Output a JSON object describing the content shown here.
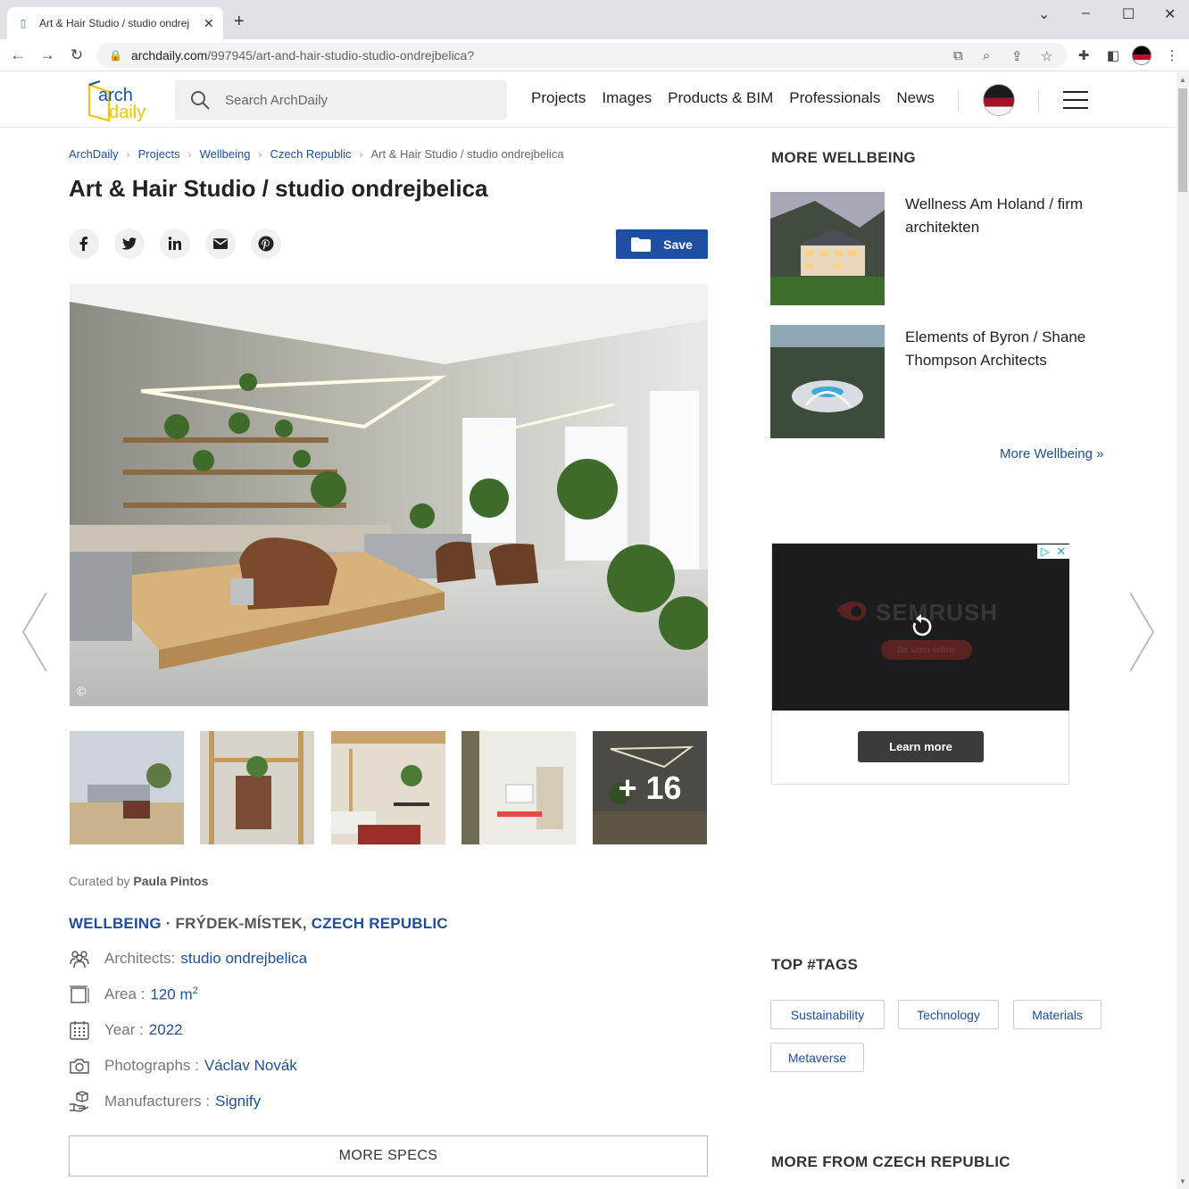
{
  "browser": {
    "tab_title": "Art & Hair Studio / studio ondrej",
    "tab_close": "✕",
    "new_tab": "+",
    "url_host": "archdaily.com",
    "url_path": "/997945/art-and-hair-studio-studio-ondrejbelica?"
  },
  "header": {
    "logo_top": "arch",
    "logo_bottom": "daily",
    "search_placeholder": "Search ArchDaily",
    "nav": [
      "Projects",
      "Images",
      "Products & BIM",
      "Professionals",
      "News"
    ]
  },
  "breadcrumb": [
    "ArchDaily",
    "Projects",
    "Wellbeing",
    "Czech Republic"
  ],
  "breadcrumb_current": "Art & Hair Studio / studio ondrejbelica",
  "page_title": "Art & Hair Studio / studio ondrejbelica",
  "save_label": "Save",
  "hero": {
    "copyright": "©"
  },
  "thumbnails": {
    "more_label": "+ 16"
  },
  "curated": {
    "prefix": "Curated by",
    "name": "Paula Pintos"
  },
  "location": {
    "category": "WELLBEING",
    "dot": "·",
    "city": "FRÝDEK-MÍSTEK,",
    "country": "CZECH REPUBLIC"
  },
  "specs": {
    "architects": {
      "label": "Architects:",
      "value": "studio ondrejbelica"
    },
    "area": {
      "label": "Area :",
      "value": "120 m",
      "sup": "2"
    },
    "year": {
      "label": "Year :",
      "value": "2022"
    },
    "photographs": {
      "label": "Photographs :",
      "value": "Václav Novák"
    },
    "manufacturers": {
      "label": "Manufacturers :",
      "value": "Signify"
    }
  },
  "more_specs_label": "MORE SPECS",
  "sidebar": {
    "more_heading": "MORE WELLBEING",
    "cards": [
      {
        "title": "Wellness Am Holand / firm architekten"
      },
      {
        "title": "Elements of Byron / Shane Thompson Architects"
      }
    ],
    "more_link": "More Wellbeing »",
    "ad": {
      "brand": "SEMRUSH",
      "pill": "Be seen online",
      "cta": "Learn more"
    },
    "tags_heading": "TOP #TAGS",
    "tags": [
      "Sustainability",
      "Technology",
      "Materials",
      "Metaverse"
    ],
    "country_heading": "MORE FROM CZECH REPUBLIC"
  },
  "colors": {
    "link_blue": "#1e4fa0",
    "logo_blue": "#1e4fa0",
    "logo_yellow": "#f3c400",
    "ad_bg": "#1c1b1d"
  }
}
